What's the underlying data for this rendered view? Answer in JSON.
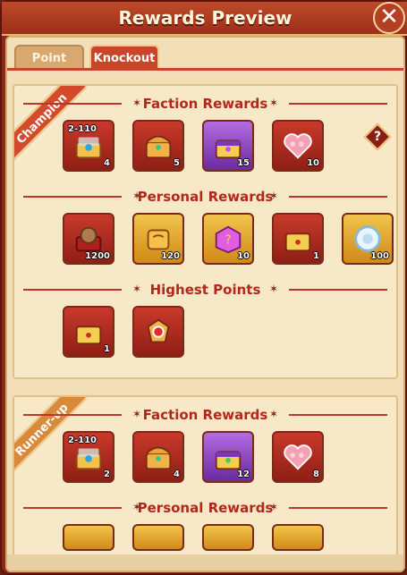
{
  "window": {
    "title": "Rewards Preview"
  },
  "tabs": [
    {
      "label": "Point"
    },
    {
      "label": "Knockout"
    }
  ],
  "help": {
    "label": "?"
  },
  "champion": {
    "ribbon": "Champion",
    "sections": {
      "faction": {
        "title": "Faction Rewards",
        "items": [
          {
            "icon": "treasure-chest-open-icon",
            "count": "4",
            "badge": "2-110"
          },
          {
            "icon": "treasure-chest-icon",
            "count": "5"
          },
          {
            "icon": "golden-chest-purple-icon",
            "count": "15"
          },
          {
            "icon": "flower-heart-icon",
            "count": "10"
          }
        ]
      },
      "personal": {
        "title": "Personal Rewards",
        "items": [
          {
            "icon": "red-box-orb-icon",
            "count": "1200"
          },
          {
            "icon": "gold-scroll-icon",
            "count": "120"
          },
          {
            "icon": "mystery-box-icon",
            "count": "10"
          },
          {
            "icon": "golden-chest-icon",
            "count": "1"
          },
          {
            "icon": "silver-token-icon",
            "count": "100"
          }
        ]
      },
      "highest": {
        "title": "Highest Points",
        "items": [
          {
            "icon": "golden-chest-icon",
            "count": "1"
          },
          {
            "icon": "medal-badge-icon",
            "count": ""
          }
        ]
      }
    }
  },
  "runner_up": {
    "ribbon": "Runner-up",
    "sections": {
      "faction": {
        "title": "Faction Rewards",
        "items": [
          {
            "icon": "treasure-chest-open-icon",
            "count": "2",
            "badge": "2-110"
          },
          {
            "icon": "treasure-chest-icon",
            "count": "4"
          },
          {
            "icon": "golden-chest-purple-icon",
            "count": "12"
          },
          {
            "icon": "flower-heart-icon",
            "count": "8"
          }
        ]
      },
      "personal": {
        "title": "Personal Rewards"
      }
    }
  }
}
